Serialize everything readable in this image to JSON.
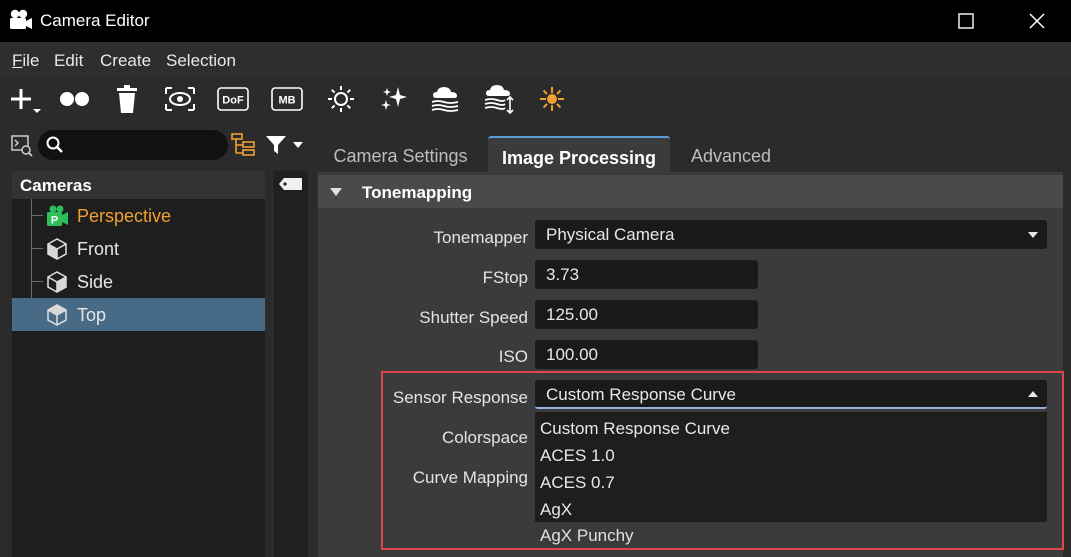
{
  "window": {
    "title": "Camera Editor",
    "app_icon": "camera-reel-icon",
    "controls": [
      "maximize-icon",
      "close-icon"
    ]
  },
  "menu": {
    "items": [
      {
        "label": "File",
        "underline": "F",
        "rest": "ile"
      },
      {
        "label": "Edit"
      },
      {
        "label": "Create"
      },
      {
        "label": "Selection"
      }
    ]
  },
  "toolbar": {
    "icons": [
      "add-icon",
      "cameras-icon",
      "delete-icon",
      "view-icon",
      "dof-icon",
      "mb-icon",
      "sun-icon",
      "sparkle-icon",
      "fog-icon",
      "fog-height-icon",
      "light-icon"
    ],
    "dof_label": "DoF",
    "mb_label": "MB"
  },
  "search": {
    "placeholder": ""
  },
  "tree": {
    "header": "Cameras",
    "items": [
      {
        "label": "Perspective",
        "icon": "perspective-camera-icon",
        "active": true
      },
      {
        "label": "Front",
        "icon": "cube-icon"
      },
      {
        "label": "Side",
        "icon": "cube-icon"
      },
      {
        "label": "Top",
        "icon": "cube-icon",
        "selected": true
      }
    ]
  },
  "tabs": [
    {
      "label": "Camera Settings"
    },
    {
      "label": "Image Processing",
      "active": true
    },
    {
      "label": "Advanced"
    }
  ],
  "section": {
    "title": "Tonemapping"
  },
  "properties": {
    "tonemapper": {
      "label": "Tonemapper",
      "value": "Physical Camera"
    },
    "fstop": {
      "label": "FStop",
      "value": "3.73"
    },
    "shutter": {
      "label": "Shutter Speed",
      "value": "125.00"
    },
    "iso": {
      "label": "ISO",
      "value": "100.00"
    },
    "sensor": {
      "label": "Sensor Response",
      "value": "Custom Response Curve"
    },
    "colorspace": {
      "label": "Colorspace"
    },
    "curve_mapping": {
      "label": "Curve Mapping"
    }
  },
  "dropdown_options": [
    "Custom Response Curve",
    "ACES 1.0",
    "ACES 0.7",
    "AgX",
    "AgX Punchy"
  ],
  "colors": {
    "accent": "#f0a030",
    "selection": "#476b87",
    "highlight_border": "#e0454a",
    "tab_indicator": "#5b9bd5"
  }
}
